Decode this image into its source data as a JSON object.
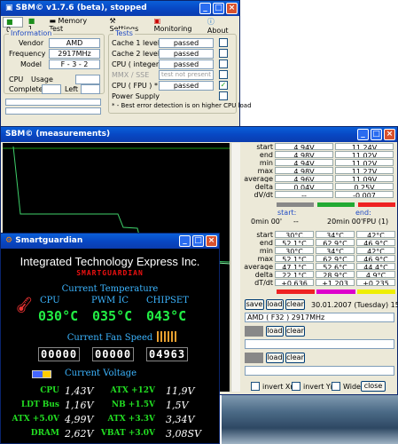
{
  "top": {
    "title": "SBM© v1.7.6 (beta), stopped",
    "tabs": [
      "0",
      "1",
      "Memory Test",
      "Settings",
      "Monitoring",
      "About"
    ],
    "info": {
      "group": "Information",
      "vendor_lbl": "Vendor",
      "vendor": "AMD",
      "freq_lbl": "Frequency",
      "freq": "2917MHz",
      "model_lbl": "Model",
      "model": "F - 3 - 2",
      "cpu_lbl": "CPU",
      "usage_lbl": "Usage",
      "completed_lbl": "Completed",
      "left_lbl": "Left"
    },
    "tests": {
      "group": "Tests",
      "items": [
        {
          "label": "Cache 1 level",
          "result": "passed",
          "checked": false
        },
        {
          "label": "Cache 2 level",
          "result": "passed",
          "checked": false
        },
        {
          "label": "CPU ( integer )",
          "result": "passed",
          "checked": false
        },
        {
          "label": "MMX / SSE",
          "result": "test not present",
          "checked": false
        },
        {
          "label": "CPU ( FPU ) *",
          "result": "passed",
          "checked": true
        },
        {
          "label": "Power Supply",
          "result": "",
          "checked": false
        }
      ],
      "note": "* - Best error detection is on higher CPU load"
    }
  },
  "meas": {
    "title": "SBM© (measurements)",
    "t1": {
      "rows": [
        [
          "start",
          "4.94V",
          "11.24V"
        ],
        [
          "end",
          "4.98V",
          "11.02V"
        ],
        [
          "min",
          "4.94V",
          "11.02V"
        ],
        [
          "max",
          "4.98V",
          "11.27V"
        ],
        [
          "average",
          "4.96V",
          "11.09V"
        ],
        [
          "delta",
          "0.04V",
          "0.25V"
        ],
        [
          "dV/dt",
          "--",
          "-0.007"
        ]
      ]
    },
    "start_lbl": "start:",
    "end_lbl": "end:",
    "start_time": "0min 00'",
    "start_dash": "--",
    "end_time": "20min 00'",
    "end_fpu": "FPU (1)",
    "t2": {
      "rows": [
        [
          "start",
          "30°C",
          "34°C",
          "42°C"
        ],
        [
          "end",
          "52.1°C",
          "62.9°C",
          "46.9°C"
        ],
        [
          "min",
          "30°C",
          "34°C",
          "42°C"
        ],
        [
          "max",
          "52.1°C",
          "62.9°C",
          "46.9°C"
        ],
        [
          "average",
          "47.1°C",
          "52.6°C",
          "44.4°C"
        ],
        [
          "delta",
          "22.1°C",
          "28.9°C",
          "4.9°C"
        ],
        [
          "dT/dt",
          "+0.636",
          "+1.203",
          "+0.235"
        ]
      ]
    },
    "save": "save",
    "load": "load",
    "clear": "clear",
    "date": "30.01.2007 (Tuesday)  15:13",
    "cpu_line": "AMD ( F32 ) 2917MHz",
    "invx": "invert Xm",
    "invy": "invert Ym",
    "wide": "Wide",
    "close": "close"
  },
  "sg": {
    "title": "Smartguardian",
    "brand": "Integrated Technology Express Inc.",
    "sub": "SMARTGUARDIAN",
    "temp_head": "Current Temperature",
    "temp_labels": [
      "CPU",
      "PWM IC",
      "CHIPSET"
    ],
    "temps": [
      "030°C",
      "035°C",
      "043°C"
    ],
    "fan_head": "Current Fan Speed",
    "fans": [
      "00000",
      "00000",
      "04963"
    ],
    "volt_head": "Current Voltage",
    "volts": [
      [
        "CPU",
        "1,43V",
        "ATX +12V",
        "11,9V"
      ],
      [
        "LDT Bus",
        "1,16V",
        "NB +1.5V",
        "1,5V"
      ],
      [
        "ATX +5.0V",
        "4,99V",
        "ATX +3.3V",
        "3,34V"
      ],
      [
        "DRAM",
        "2,62V",
        "VBAT +3.0V",
        "3,08SV"
      ]
    ]
  }
}
